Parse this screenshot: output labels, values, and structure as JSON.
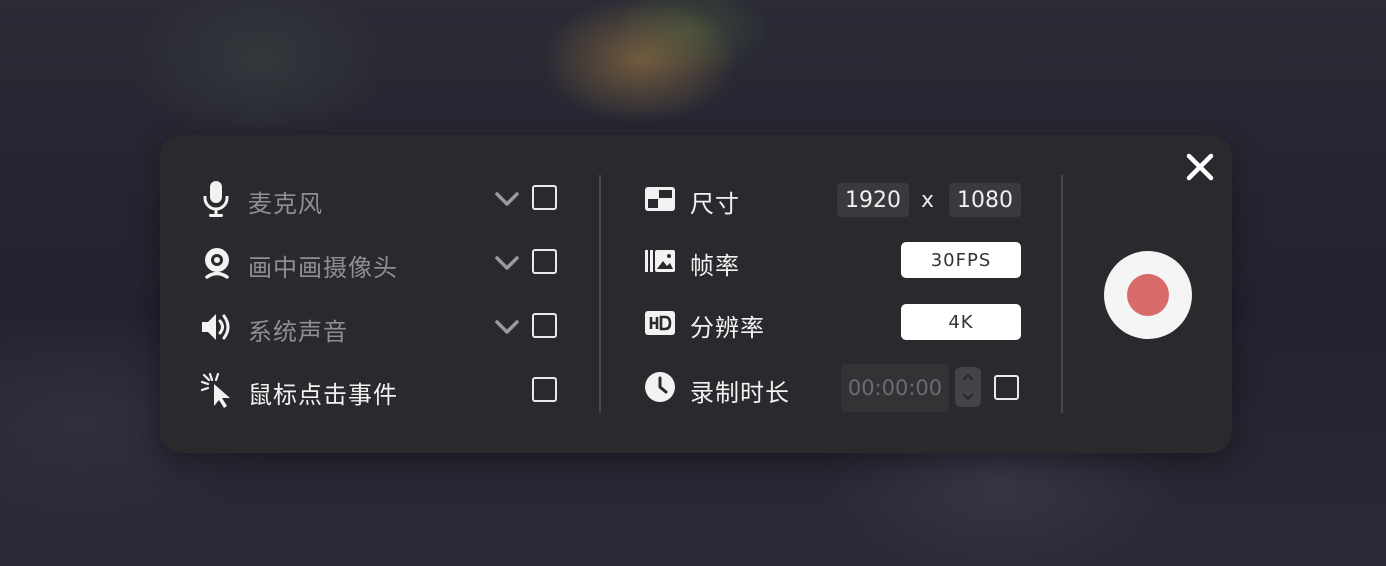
{
  "sources": {
    "microphone": {
      "label": "麦克风",
      "icon": "microphone-icon"
    },
    "pip_camera": {
      "label": "画中画摄像头",
      "icon": "webcam-icon"
    },
    "system_audio": {
      "label": "系统声音",
      "icon": "speaker-icon"
    },
    "mouse_click": {
      "label": "鼠标点击事件",
      "icon": "cursor-click-icon"
    }
  },
  "settings": {
    "size": {
      "label": "尺寸",
      "width": "1920",
      "separator": "x",
      "height": "1080",
      "icon": "screen-size-icon"
    },
    "frame_rate": {
      "label": "帧率",
      "value": "30FPS",
      "icon": "frames-icon"
    },
    "resolution": {
      "label": "分辨率",
      "value": "4K",
      "icon": "hd-icon"
    },
    "duration": {
      "label": "录制时长",
      "value": "00:00:00",
      "icon": "clock-icon"
    }
  },
  "colors": {
    "panel": "#2a2a2e",
    "record_dot": "#d86a6a",
    "record_button": "#f4f4f4"
  }
}
